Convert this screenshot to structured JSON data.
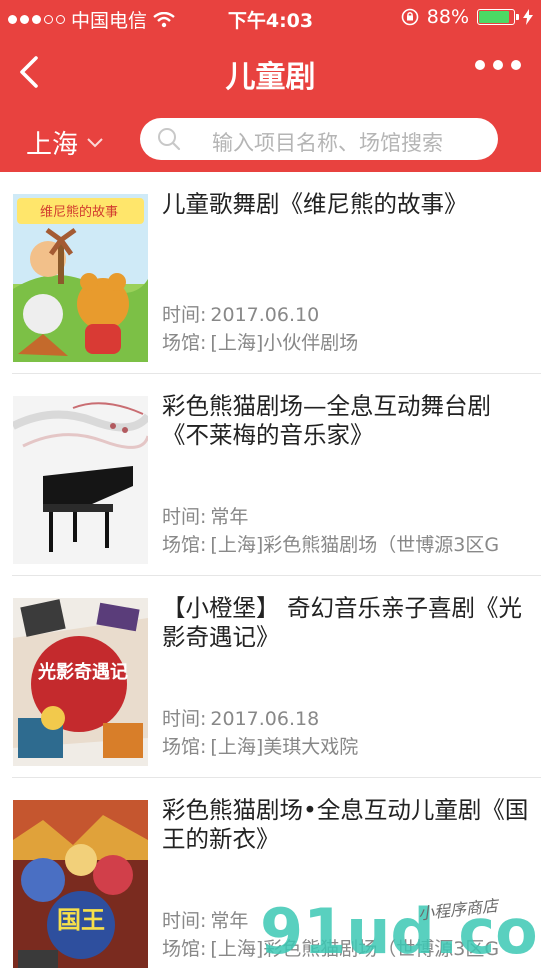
{
  "status_bar": {
    "carrier": "中国电信",
    "time": "下午4:03",
    "battery": "88%",
    "battery_level": 0.88,
    "signal_bars": 3,
    "signal_total": 5
  },
  "nav": {
    "title": "儿童剧"
  },
  "filter": {
    "city": "上海",
    "search_placeholder": "输入项目名称、场馆搜索"
  },
  "items": [
    {
      "title": "儿童歌舞剧《维尼熊的故事》",
      "time_label": "时间:",
      "time": "2017.06.10",
      "venue_label": "场馆:",
      "venue": "[上海]小伙伴剧场",
      "poster_caption": "维尼熊的故事"
    },
    {
      "title": "彩色熊猫剧场—全息互动舞台剧《不莱梅的音乐家》",
      "time_label": "时间:",
      "time": "常年",
      "venue_label": "场馆:",
      "venue": "[上海]彩色熊猫剧场（世博源3区G"
    },
    {
      "title": "【小橙堡】 奇幻音乐亲子喜剧《光影奇遇记》",
      "time_label": "时间:",
      "time": "2017.06.18",
      "venue_label": "场馆:",
      "venue": "[上海]美琪大戏院",
      "poster_caption": "光影奇遇记"
    },
    {
      "title": "彩色熊猫剧场•全息互动儿童剧《国王的新衣》",
      "time_label": "时间:",
      "time": "常年",
      "venue_label": "场馆:",
      "venue": "[上海]彩色熊猫剧场（世博源3区G",
      "poster_caption": "国王"
    }
  ],
  "watermark": {
    "main": "91ud.com",
    "script": "小程序商店"
  }
}
